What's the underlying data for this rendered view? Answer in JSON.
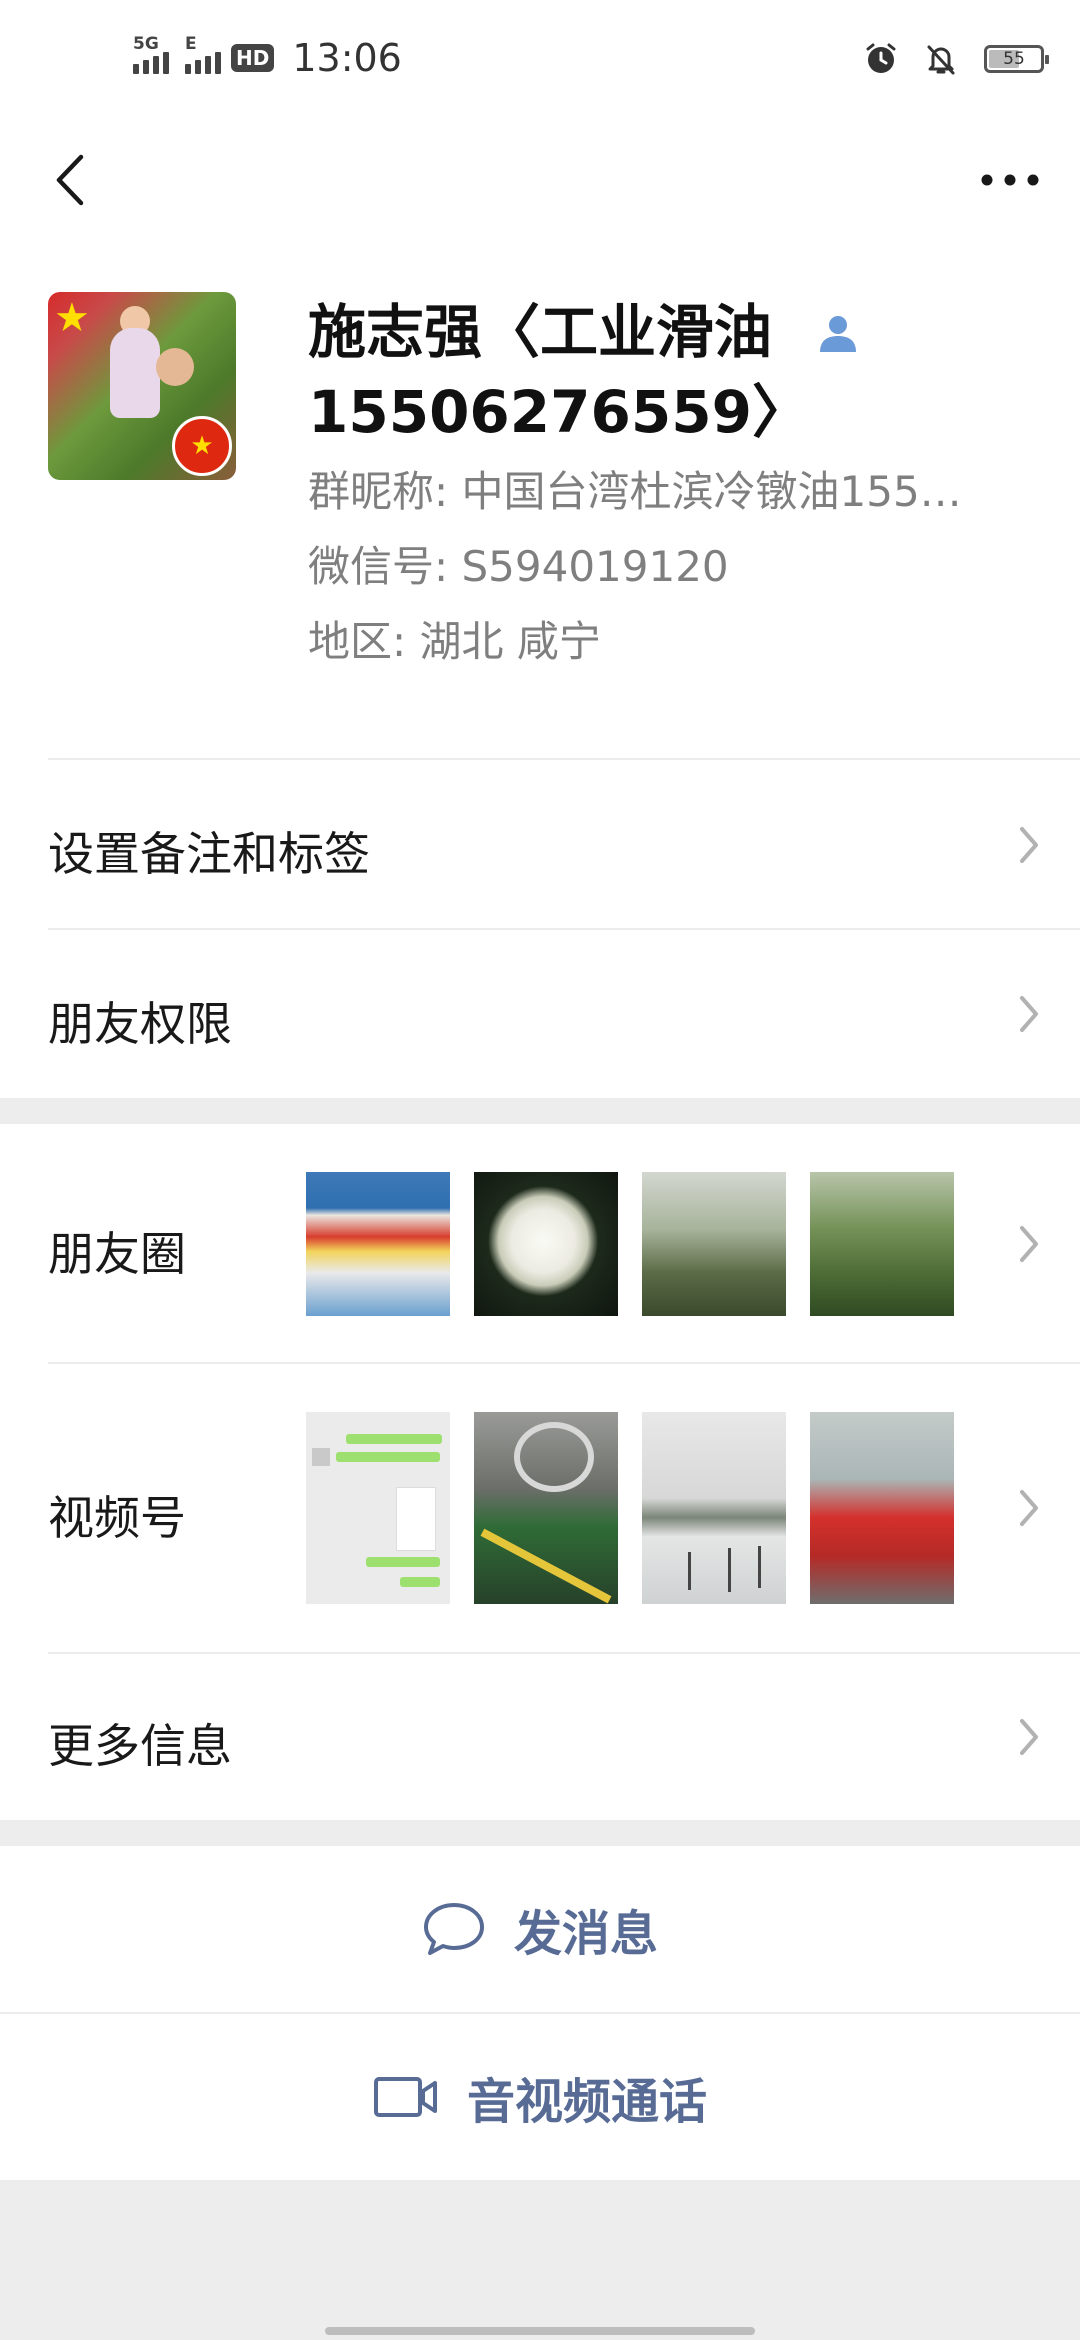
{
  "status_bar": {
    "network1": "5G",
    "network2": "E",
    "hd": "HD",
    "time": "13:06",
    "battery": "55",
    "icons": [
      "alarm-icon",
      "mute-bell-icon",
      "battery-icon"
    ]
  },
  "nav": {
    "back_icon": "chevron-left-icon",
    "more_icon": "ellipsis-icon"
  },
  "profile": {
    "name": "施志强〈工业滑油15506276559〉",
    "group_nickname": "群昵称:  中国台湾杜滨冷镦油155…",
    "wechat_id": "微信号:  S594019120",
    "region": "地区:  湖北  咸宁"
  },
  "rows": {
    "remarks": "设置备注和标签",
    "permissions": "朋友权限",
    "moments": "朋友圈",
    "channels": "视频号",
    "more_info": "更多信息"
  },
  "actions": {
    "message": "发消息",
    "call": "音视频通话"
  },
  "colors": {
    "link": "#576b95",
    "background": "#ededed"
  }
}
